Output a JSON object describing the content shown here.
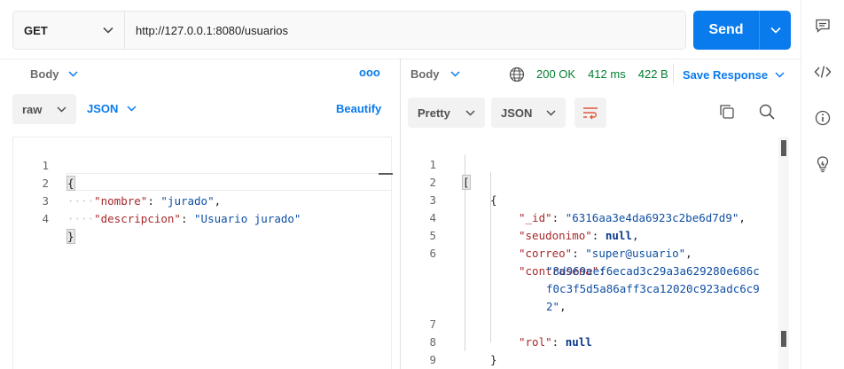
{
  "request": {
    "method": "GET",
    "url": "http://127.0.0.1:8080/usuarios",
    "send_label": "Send",
    "body_tab_label": "Body",
    "more_label": "ooo",
    "body_mode": "raw",
    "body_language": "JSON",
    "beautify_label": "Beautify",
    "lines": [
      {
        "num": "1",
        "text": "{"
      },
      {
        "num": "2",
        "key": "\"nombre\"",
        "value": "\"jurado\"",
        "tail": ","
      },
      {
        "num": "3",
        "key": "\"descripcion\"",
        "value": "\"Usuario jurado\"",
        "tail": ""
      },
      {
        "num": "4",
        "text": "}"
      }
    ]
  },
  "response": {
    "body_tab_label": "Body",
    "status": "200 OK",
    "time": "412 ms",
    "size": "422 B",
    "save_label": "Save Response",
    "view_mode": "Pretty",
    "language": "JSON",
    "lines": [
      {
        "num": "1",
        "text": "["
      },
      {
        "num": "2",
        "text": "{"
      },
      {
        "num": "3",
        "key": "\"_id\"",
        "value": "\"6316aa3e4da6923c2be6d7d9\"",
        "tail": ","
      },
      {
        "num": "4",
        "key": "\"seudonimo\"",
        "kw": "null",
        "tail": ","
      },
      {
        "num": "5",
        "key": "\"correo\"",
        "value": "\"super@usuario\"",
        "tail": ","
      },
      {
        "num": "6",
        "key": "\"contrasena\"",
        "tail": ":"
      },
      {
        "num": "",
        "value": "\"8d969eef6ecad3c29a3a629280e686c"
      },
      {
        "num": "",
        "value": "f0c3f5d5a86aff3ca12020c923adc6c9"
      },
      {
        "num": "",
        "value": "2\"",
        "tail": ","
      },
      {
        "num": "7",
        "key": "\"rol\"",
        "kw": "null"
      },
      {
        "num": "8",
        "text": "}"
      },
      {
        "num": "9",
        "text": "]"
      }
    ]
  },
  "colors": {
    "accent": "#097bed",
    "status_ok": "#007f31",
    "json_key": "#a8282a",
    "json_string": "#0f4fa3"
  },
  "icons": [
    "comment-icon",
    "code-icon",
    "info-icon",
    "lightbulb-icon",
    "globe-icon",
    "wrap-lines-icon",
    "copy-icon",
    "search-icon",
    "chevron-down-icon"
  ]
}
